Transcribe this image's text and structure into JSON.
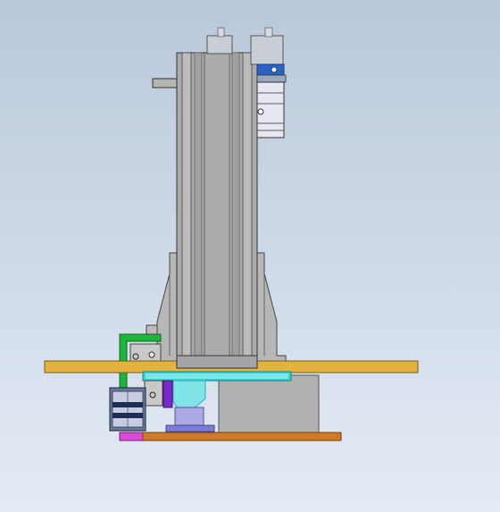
{
  "viewport": {
    "background_top": "#b9c8da",
    "background_bottom": "#e4ebf5"
  },
  "colors": {
    "steel": "#a9a9a9",
    "steel_light": "#c4c4c4",
    "steel_dark": "#6e6e6e",
    "edge": "#333333",
    "plate_gold": "#e2b33e",
    "plate_orange": "#cf7a2a",
    "cyan_block": "#39d3d3",
    "cyan_light": "#7fe3e8",
    "green_bracket": "#1db53b",
    "purple": "#7a28c8",
    "magenta": "#d94ad9",
    "lavender": "#a9a9e6",
    "motor_blue": "#2a63c2",
    "motor_body": "#e7e7f2"
  },
  "parts": [
    {
      "name": "vertical-linear-actuator",
      "icon": "actuator-icon"
    },
    {
      "name": "servo-motor",
      "icon": "motor-icon"
    },
    {
      "name": "left-mounting-bracket",
      "icon": "bracket-icon"
    },
    {
      "name": "right-mounting-bracket",
      "icon": "bracket-icon"
    },
    {
      "name": "base-plate",
      "icon": "plate-icon"
    },
    {
      "name": "carriage-plate",
      "icon": "plate-icon"
    },
    {
      "name": "bottom-plate",
      "icon": "plate-icon"
    },
    {
      "name": "gripper-cylinder",
      "icon": "cylinder-icon"
    },
    {
      "name": "green-bracket",
      "icon": "bracket-icon"
    },
    {
      "name": "base-block",
      "icon": "block-icon"
    }
  ]
}
